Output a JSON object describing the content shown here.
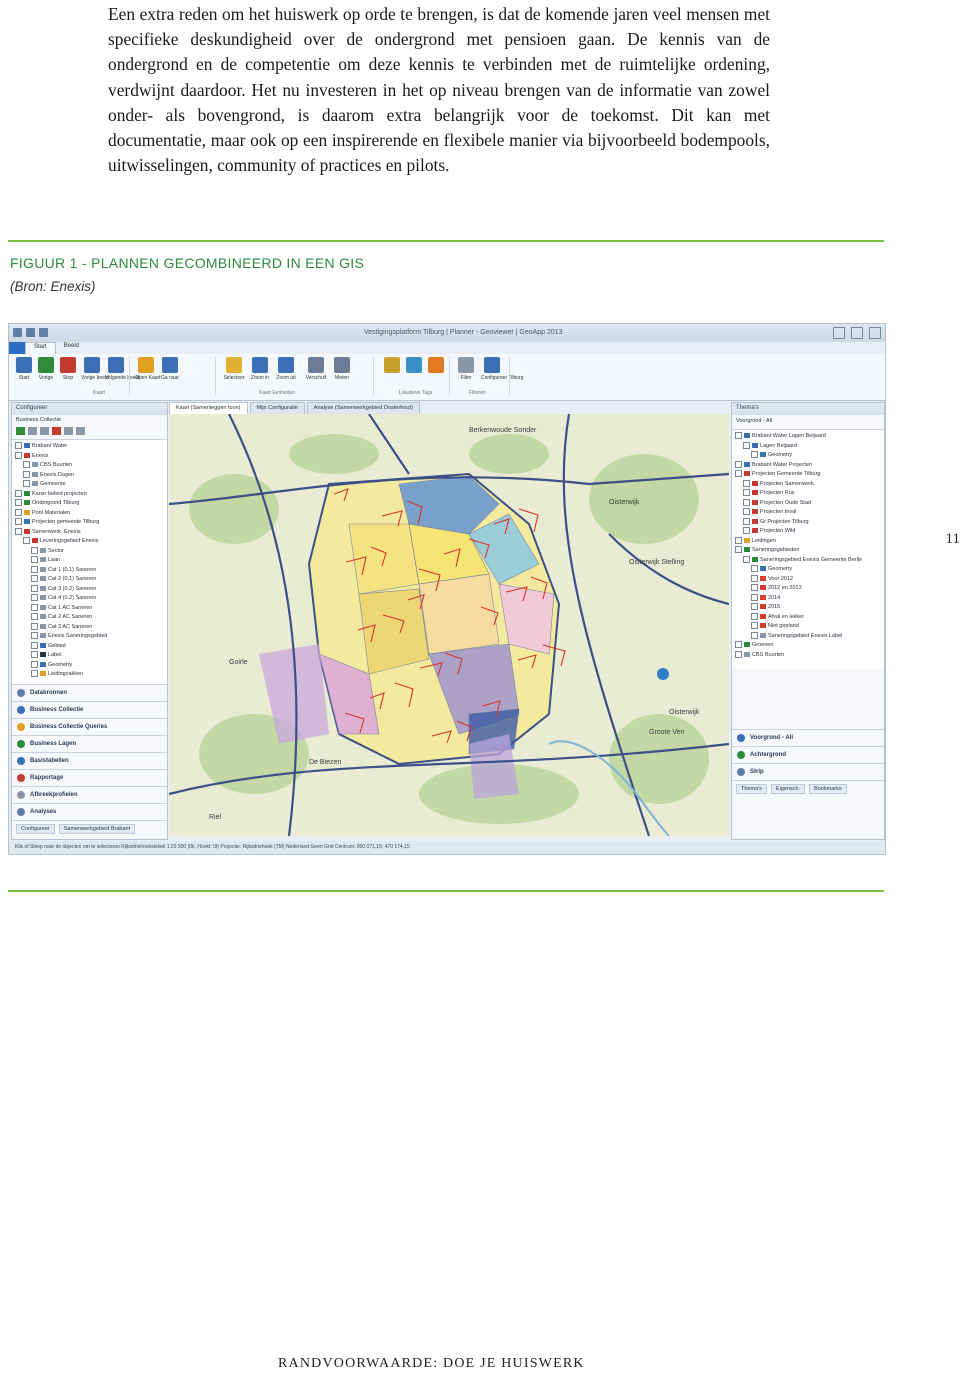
{
  "body_text": "Een extra reden om het huiswerk op orde te brengen, is dat de komende jaren veel mensen met specifieke deskundigheid over de ondergrond met pensioen gaan. De kennis van de ondergrond en de competentie om deze kennis te verbinden met de ruimtelijke ordening, verdwijnt daardoor. Het nu investeren in het op niveau brengen van de informatie van zowel onder- als bovengrond, is daarom extra belangrijk voor de toekomst. Dit kan met documentatie, maar ook op een inspirerende en flexibele manier via bijvoorbeeld bodempools, uitwisselingen, community of practices en pilots.",
  "figure": {
    "title": "FIGUUR 1 - PLANNEN GECOMBINEERD IN EEN GIS",
    "source": "(Bron: Enexis)"
  },
  "page_number": "11",
  "footer": "RANDVOORWAARDE: DOE JE HUISWERK",
  "app": {
    "window_title": "Vestigingsplatform Tilburg | Planner - Geoviewer | GeoApp 2013",
    "ribbon_tabs": [
      "",
      "Start",
      "Beeld"
    ],
    "ribbon_buttons": [
      {
        "label": "Start",
        "color": "#3a6fb5"
      },
      {
        "label": "Vorige",
        "color": "#2f8a3c"
      },
      {
        "label": "Stop",
        "color": "#c43a2e"
      },
      {
        "label": "Vorige beeld",
        "color": "#3a6fb5"
      },
      {
        "label": "Volgende beeld",
        "color": "#3a6fb5"
      },
      {
        "label": "Open Kaart",
        "color": "#e0a020"
      },
      {
        "label": "Ga naar",
        "color": "#3a6fb5"
      },
      {
        "label": "Selecteer",
        "color": "#e0b030"
      },
      {
        "label": "Zoom in",
        "color": "#3a6fb5"
      },
      {
        "label": "Zoom uit",
        "color": "#3a6fb5"
      },
      {
        "label": "Verschuif",
        "color": "#6a7d95"
      },
      {
        "label": "Meten",
        "color": "#6a7d95"
      },
      {
        "label": "",
        "color": "#c9a030"
      },
      {
        "label": "",
        "color": "#3a8fc4"
      },
      {
        "label": "",
        "color": "#e07b20"
      },
      {
        "label": "Filter",
        "color": "#8a97a8"
      },
      {
        "label": "Configureer Tilburg",
        "color": "#3a6fb5"
      }
    ],
    "ribbon_groups": [
      "Kaart",
      "Kaart Eenheden",
      "Lokatieve Tags",
      "Filteren"
    ],
    "left_panel": {
      "title": "Configureer",
      "subtitle": "Business Collectie",
      "tree": [
        {
          "label": "Brabant Water",
          "level": 0,
          "color": "#3a6fb5"
        },
        {
          "label": "Enexis",
          "level": 0,
          "color": "#c43a2e"
        },
        {
          "label": "CBS Buurten",
          "level": 1,
          "color": "#8a97a8"
        },
        {
          "label": "Enexis Dagen",
          "level": 1,
          "color": "#8a97a8"
        },
        {
          "label": "Gemeente",
          "level": 1,
          "color": "#8a97a8"
        },
        {
          "label": "Kansr beleid projecten",
          "level": 0,
          "color": "#2f8a3c"
        },
        {
          "label": "Ondergrond Tilburg",
          "level": 0,
          "color": "#2f8a3c"
        },
        {
          "label": "Pool Materialen",
          "level": 0,
          "color": "#e0a020"
        },
        {
          "label": "Projecten gemeente Tilburg",
          "level": 0,
          "color": "#3a6fb5"
        },
        {
          "label": "Samenwerk. Enexis",
          "level": 0,
          "color": "#c43a2e"
        },
        {
          "label": "Leveringsgebied Enexis",
          "level": 1,
          "color": "#c43a2e"
        },
        {
          "label": "Sector",
          "level": 2,
          "color": "#8a97a8"
        },
        {
          "label": "Laan",
          "level": 2,
          "color": "#8a97a8"
        },
        {
          "label": "Cat 1 (0,1) Saneren",
          "level": 2,
          "color": "#8a97a8"
        },
        {
          "label": "Cat 2 (0,1) Saneren",
          "level": 2,
          "color": "#8a97a8"
        },
        {
          "label": "Cat 3 (0,2) Saneren",
          "level": 2,
          "color": "#8a97a8"
        },
        {
          "label": "Cat 4 (0,2) Saneren",
          "level": 2,
          "color": "#8a97a8"
        },
        {
          "label": "Cat 1 AC Saneren",
          "level": 2,
          "color": "#8a97a8"
        },
        {
          "label": "Cat 2 AC Saneren",
          "level": 2,
          "color": "#8a97a8"
        },
        {
          "label": "Cat 3 AC Saneren",
          "level": 2,
          "color": "#8a97a8"
        },
        {
          "label": "Enexis Saneringsgebied",
          "level": 2,
          "color": "#8a97a8"
        },
        {
          "label": "Gebied",
          "level": 2,
          "color": "#3a6fb5"
        },
        {
          "label": "Label",
          "level": 2,
          "color": "#2a3340"
        },
        {
          "label": "Geometry",
          "level": 2,
          "color": "#3a6fb5"
        },
        {
          "label": "Leidingvakken",
          "level": 2,
          "color": "#e0a020"
        }
      ],
      "nav_sections": [
        {
          "label": "Databronnen",
          "color": "#5f7fa8"
        },
        {
          "label": "Business Collectie",
          "color": "#3a6fb5"
        },
        {
          "label": "Business Collectie Queries",
          "color": "#e0a020"
        },
        {
          "label": "Business Lagen",
          "color": "#2f8a3c"
        },
        {
          "label": "Basistabellen",
          "color": "#3a6fb5"
        },
        {
          "label": "Rapportage",
          "color": "#c43a2e"
        },
        {
          "label": "Afbreekprofielen",
          "color": "#8a97a8"
        },
        {
          "label": "Analyses",
          "color": "#5f7fa8"
        }
      ],
      "bottom_tabs": [
        "Configureer",
        "Samenwerkgebied Brabant"
      ]
    },
    "map_tabs": [
      "Kaart (Samenleggen toon)",
      "Mijn Configuratie",
      "Analyse (Samenwerkgebied Oosterhout)"
    ],
    "map_labels": [
      "Berkenwoude Sonder",
      "Oisterwijk",
      "Oisterwijk Stelling",
      "Oisterwijk",
      "Goirle",
      "De Biezen",
      "Riel",
      "Groote Ven"
    ],
    "right_panel": {
      "title": "Thema's",
      "subtitle": "Voorgrond - All",
      "tree": [
        {
          "label": "Brabant Water Lagen Beijaard",
          "level": 0,
          "color": "#3a6fb5"
        },
        {
          "label": "Lagen Beijaard",
          "level": 1,
          "color": "#3a6fb5"
        },
        {
          "label": "Geometry",
          "level": 2,
          "color": "#3a6fb5"
        },
        {
          "label": "Brabant Water Projecten",
          "level": 0,
          "color": "#3a6fb5"
        },
        {
          "label": "Projecten Gemeente Tilburg",
          "level": 0,
          "color": "#c43a2e"
        },
        {
          "label": "Projecten Samenwerk.",
          "level": 1,
          "color": "#c43a2e"
        },
        {
          "label": "Projecten Rus",
          "level": 1,
          "color": "#c43a2e"
        },
        {
          "label": "Projecten Oude Stad",
          "level": 1,
          "color": "#c43a2e"
        },
        {
          "label": "Projecten Inval",
          "level": 1,
          "color": "#c43a2e"
        },
        {
          "label": "Gr.Projecten Tilburg",
          "level": 1,
          "color": "#c43a2e"
        },
        {
          "label": "Projecten Wild",
          "level": 1,
          "color": "#c43a2e"
        },
        {
          "label": "Leidingen",
          "level": 0,
          "color": "#e0a020"
        },
        {
          "label": "Saneringsgebieden",
          "level": 0,
          "color": "#2f8a3c"
        },
        {
          "label": "Saneringsgebied Enexis Gemeente Berlle",
          "level": 1,
          "color": "#2f8a3c"
        },
        {
          "label": "Geometry",
          "level": 2,
          "color": "#3a6fb5"
        },
        {
          "label": "Voor 2012",
          "level": 2,
          "color": "#d83a2e"
        },
        {
          "label": "2012 en 2013",
          "level": 2,
          "color": "#d83a2e"
        },
        {
          "label": "2014",
          "level": 2,
          "color": "#d83a2e"
        },
        {
          "label": "2015",
          "level": 2,
          "color": "#d83a2e"
        },
        {
          "label": "Afval en lekker",
          "level": 2,
          "color": "#d83a2e"
        },
        {
          "label": "Niet gepland",
          "level": 2,
          "color": "#d83a2e"
        },
        {
          "label": "Saneringsgebied Enexis Label",
          "level": 2,
          "color": "#8a97a8"
        },
        {
          "label": "Groenen",
          "level": 0,
          "color": "#2f8a3c"
        },
        {
          "label": "CBS Buurten",
          "level": 0,
          "color": "#8a97a8"
        }
      ],
      "nav_sections": [
        {
          "label": "Voorgrond - All",
          "color": "#3a6fb5"
        },
        {
          "label": "Achtergrond",
          "color": "#2f8a3c"
        },
        {
          "label": "Strip",
          "color": "#5f7fa8"
        }
      ],
      "bottom_tabs": [
        "Thema's",
        "Eigensch.",
        "Bookmarks"
      ]
    },
    "status_bar": "Klik of Sleep naar de objecten om te selecteren     Rijksdriehoekstelsel     1:29 500 (0k, Hoekt: 0f)     Projectie: Rijksdriehoek (TM) Nederland     Geen Grid     Centrum: 000 071,15; 470 174,15"
  }
}
